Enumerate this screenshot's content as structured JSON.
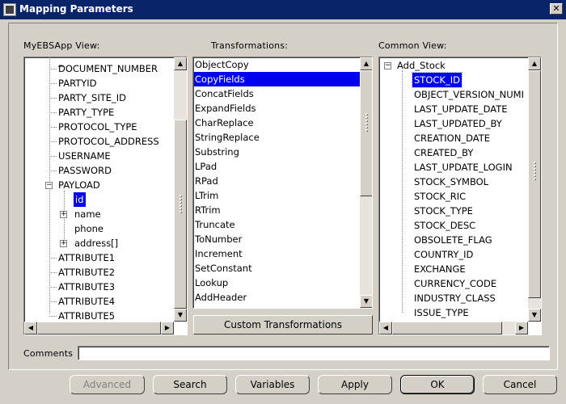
{
  "window": {
    "title": "Mapping Parameters"
  },
  "left_panel": {
    "label": "MyEBSApp View:",
    "items": [
      {
        "label": "DOCUMENT_NUMBER"
      },
      {
        "label": "PARTYID"
      },
      {
        "label": "PARTY_SITE_ID"
      },
      {
        "label": "PARTY_TYPE"
      },
      {
        "label": "PROTOCOL_TYPE"
      },
      {
        "label": "PROTOCOL_ADDRESS"
      },
      {
        "label": "USERNAME"
      },
      {
        "label": "PASSWORD"
      },
      {
        "label": "PAYLOAD"
      },
      {
        "label": "id"
      },
      {
        "label": "name"
      },
      {
        "label": "phone"
      },
      {
        "label": "address[]"
      },
      {
        "label": "ATTRIBUTE1"
      },
      {
        "label": "ATTRIBUTE2"
      },
      {
        "label": "ATTRIBUTE3"
      },
      {
        "label": "ATTRIBUTE4"
      },
      {
        "label": "ATTRIBUTE5"
      }
    ]
  },
  "middle_panel": {
    "label": "Transformations:",
    "items": [
      {
        "label": "ObjectCopy"
      },
      {
        "label": "CopyFields"
      },
      {
        "label": "ConcatFields"
      },
      {
        "label": "ExpandFields"
      },
      {
        "label": "CharReplace"
      },
      {
        "label": "StringReplace"
      },
      {
        "label": "Substring"
      },
      {
        "label": "LPad"
      },
      {
        "label": "RPad"
      },
      {
        "label": "LTrim"
      },
      {
        "label": "RTrim"
      },
      {
        "label": "Truncate"
      },
      {
        "label": "ToNumber"
      },
      {
        "label": "Increment"
      },
      {
        "label": "SetConstant"
      },
      {
        "label": "Lookup"
      },
      {
        "label": "AddHeader"
      }
    ],
    "selected": "CopyFields",
    "custom_button": "Custom Transformations"
  },
  "right_panel": {
    "label": "Common View:",
    "items": [
      {
        "label": "Add_Stock"
      },
      {
        "label": "STOCK_ID"
      },
      {
        "label": "OBJECT_VERSION_NUMI"
      },
      {
        "label": "LAST_UPDATE_DATE"
      },
      {
        "label": "LAST_UPDATED_BY"
      },
      {
        "label": "CREATION_DATE"
      },
      {
        "label": "CREATED_BY"
      },
      {
        "label": "LAST_UPDATE_LOGIN"
      },
      {
        "label": "STOCK_SYMBOL"
      },
      {
        "label": "STOCK_RIC"
      },
      {
        "label": "STOCK_TYPE"
      },
      {
        "label": "STOCK_DESC"
      },
      {
        "label": "OBSOLETE_FLAG"
      },
      {
        "label": "COUNTRY_ID"
      },
      {
        "label": "EXCHANGE"
      },
      {
        "label": "CURRENCY_CODE"
      },
      {
        "label": "INDUSTRY_CLASS"
      },
      {
        "label": "ISSUE_TYPE"
      }
    ]
  },
  "comments": {
    "label": "Comments",
    "value": ""
  },
  "buttons": {
    "advanced": "Advanced",
    "search": "Search",
    "variables": "Variables",
    "apply": "Apply",
    "ok": "OK",
    "cancel": "Cancel"
  },
  "colors": {
    "titlebar": "#0a246a",
    "selection": "#0000ee",
    "face": "#d4d0c8"
  }
}
